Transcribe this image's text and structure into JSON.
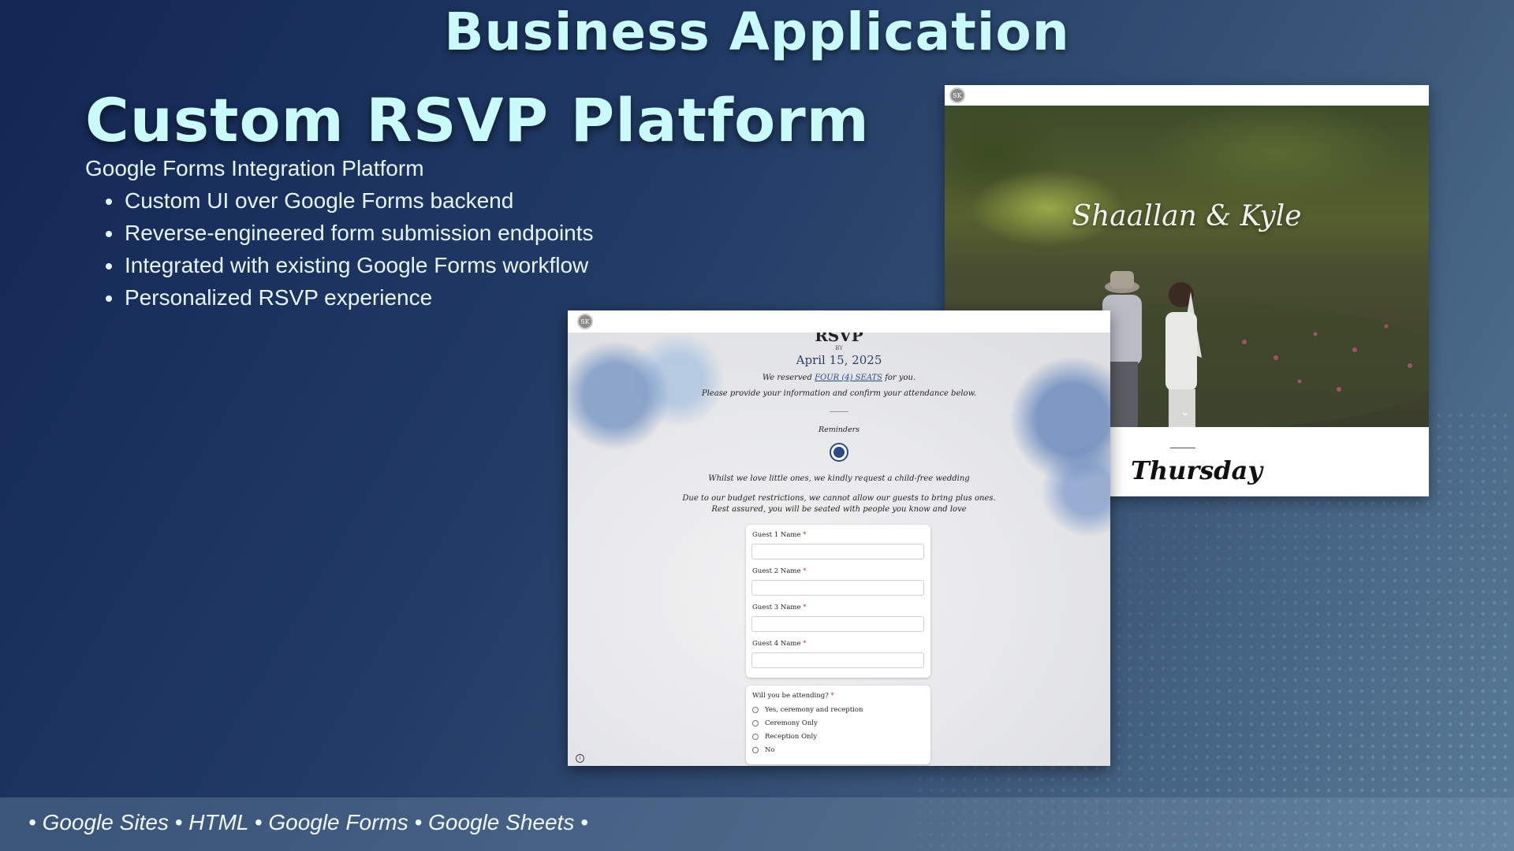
{
  "slide": {
    "title": "Business Application",
    "project_title": "Custom RSVP Platform",
    "subtitle": "Google Forms Integration Platform",
    "bullets": [
      "Custom UI over Google Forms backend",
      "Reverse-engineered form submission endpoints",
      "Integrated with existing Google Forms workflow",
      "Personalized RSVP experience"
    ],
    "footer": "• Google Sites • HTML • Google Forms • Google Sheets •"
  },
  "wedding_site": {
    "logo": "SK",
    "couple": "Shaallan & Kyle",
    "day": "Thursday",
    "chevron": "⌄"
  },
  "rsvp_form": {
    "logo": "SK",
    "heading": "RSVP",
    "by": "BY",
    "date": "April 15, 2025",
    "reserved_prefix": "We reserved ",
    "reserved_link": "FOUR (4) SEATS",
    "reserved_suffix": " for you.",
    "instructions": "Please provide your information and confirm your attendance below.",
    "reminders": "Reminders",
    "child_free": "Whilst we love little ones, we kindly request a child-free wedding",
    "budget": "Due to our budget restrictions, we cannot allow our guests to bring plus ones. Rest assured, you will be seated with people you know and love",
    "required_mark": "*",
    "guests": [
      {
        "label": "Guest 1 Name",
        "value": ""
      },
      {
        "label": "Guest 2 Name",
        "value": ""
      },
      {
        "label": "Guest 3 Name",
        "value": ""
      },
      {
        "label": "Guest 4 Name",
        "value": ""
      }
    ],
    "attending_question": "Will you be attending?",
    "attending_options": [
      "Yes, ceremony and reception",
      "Ceremony Only",
      "Reception Only",
      "No"
    ],
    "info_icon": "i"
  }
}
